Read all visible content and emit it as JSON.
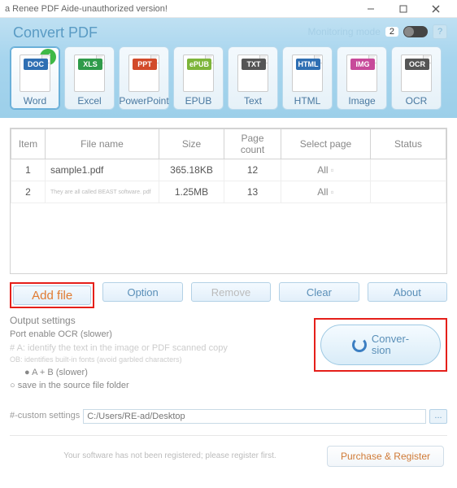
{
  "window": {
    "title": "a Renee PDF Aide-unauthorized version!"
  },
  "header": {
    "title": "Convert PDF",
    "monitoring_label": "Monitoring mode",
    "monitoring_count": "2",
    "help": "?"
  },
  "formats": [
    {
      "label": "Word",
      "tag": "DOC",
      "tagColor": "#2f6fb3",
      "selected": true
    },
    {
      "label": "Excel",
      "tag": "XLS",
      "tagColor": "#2f9b4a",
      "selected": false
    },
    {
      "label": "PowerPoint",
      "tag": "PPT",
      "tagColor": "#d24a2a",
      "selected": false
    },
    {
      "label": "EPUB",
      "tag": "ePUB",
      "tagColor": "#7db53a",
      "selected": false
    },
    {
      "label": "Text",
      "tag": "TXT",
      "tagColor": "#555",
      "selected": false
    },
    {
      "label": "HTML",
      "tag": "HTML",
      "tagColor": "#2f6fb3",
      "selected": false
    },
    {
      "label": "Image",
      "tag": "IMG",
      "tagColor": "#c74a9a",
      "selected": false
    },
    {
      "label": "OCR",
      "tag": "OCR",
      "tagColor": "#555",
      "selected": false
    }
  ],
  "table": {
    "headers": {
      "item": "Item",
      "filename": "File name",
      "size": "Size",
      "pagecount": "Page count",
      "selectpage": "Select page",
      "status": "Status"
    },
    "rows": [
      {
        "item": "1",
        "filename": "sample1.pdf",
        "tiny": false,
        "size": "365.18KB",
        "pagecount": "12",
        "selectpage": "All",
        "status": ""
      },
      {
        "item": "2",
        "filename": "They are all called BEAST software. pdf",
        "tiny": true,
        "size": "1.25MB",
        "pagecount": "13",
        "selectpage": "All",
        "status": ""
      }
    ]
  },
  "buttons": {
    "add_file": "Add file",
    "option": "Option",
    "remove": "Remove",
    "clear": "Clear",
    "about": "About"
  },
  "settings": {
    "heading": "Output settings",
    "ocr": "Port enable OCR (slower)",
    "a_desc": "# A: identify the text in the image or PDF scanned copy",
    "ob_desc": "OB: identifies built-in fonts (avoid garbled characters)",
    "ab": "● A + B (slower)",
    "save_source": "○ save in the source file folder",
    "custom_prefix": "#-custom settings",
    "path": "C:/Users/RE-ad/Desktop",
    "browse": "..."
  },
  "convert": {
    "label": "Conver-\nsion"
  },
  "footer": {
    "msg": "Your software has not been registered; please register first.",
    "purchase": "Purchase & Register"
  }
}
